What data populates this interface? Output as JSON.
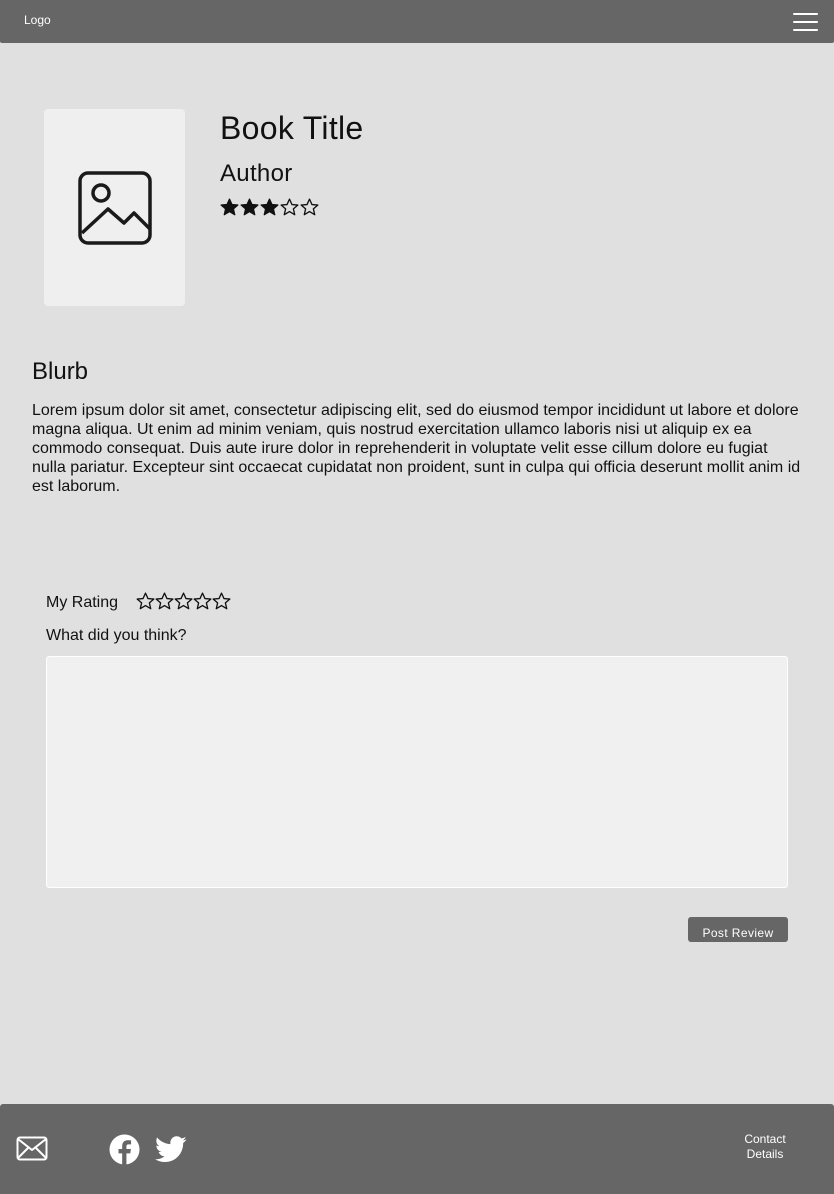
{
  "header": {
    "logo": "Logo",
    "menu_icon": "hamburger-menu-icon"
  },
  "book": {
    "cover_icon": "image-placeholder-icon",
    "title": "Book Title",
    "author": "Author",
    "average_rating": 3,
    "rating_max": 5
  },
  "blurb": {
    "heading": "Blurb",
    "text": "Lorem ipsum dolor sit amet, consectetur adipiscing elit, sed do eiusmod tempor incididunt ut labore et dolore magna aliqua. Ut enim ad minim veniam, quis nostrud exercitation ullamco laboris nisi ut aliquip ex ea commodo consequat. Duis aute irure dolor in reprehenderit in voluptate velit esse cillum dolore eu fugiat nulla pariatur. Excepteur sint occaecat cupidatat non proident, sunt in culpa qui officia deserunt mollit anim id est laborum."
  },
  "review": {
    "my_rating_label": "My Rating",
    "my_rating": 0,
    "rating_max": 5,
    "question": "What did you think?",
    "text_value": "",
    "post_button": "Post Review"
  },
  "footer": {
    "icons": [
      "mail-icon",
      "facebook-icon",
      "twitter-icon"
    ],
    "contact_line1": "Contact",
    "contact_line2": "Details"
  },
  "colors": {
    "page_background": "#e0e0e0",
    "bar_background": "#666666",
    "panel_background": "#efefef",
    "text": "#111111"
  }
}
